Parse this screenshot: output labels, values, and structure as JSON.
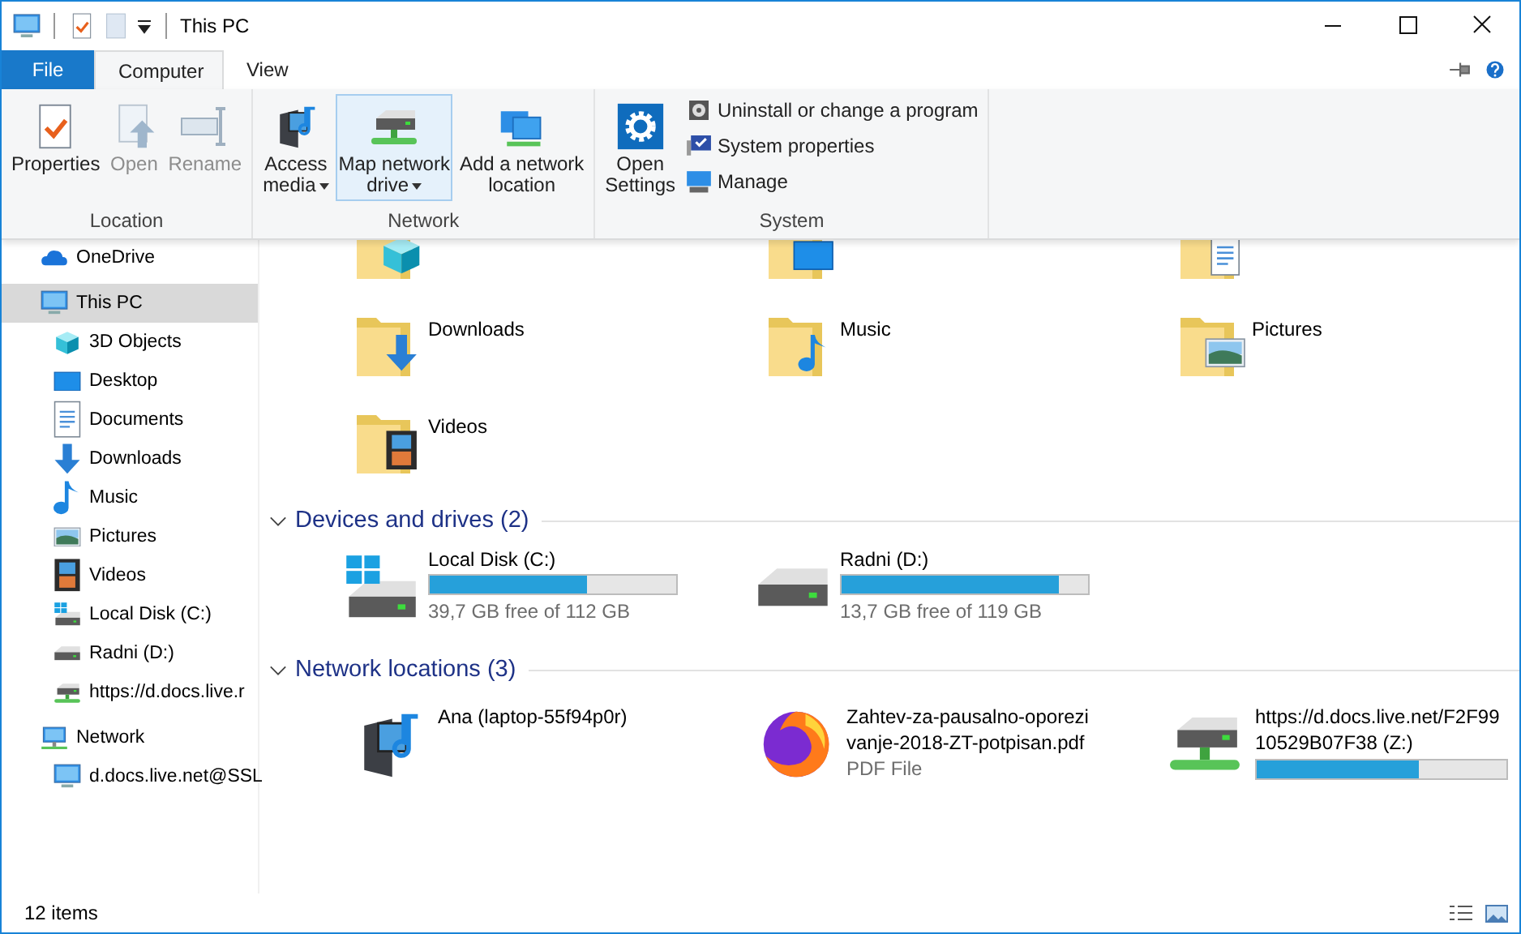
{
  "window": {
    "title": "This PC"
  },
  "ribbon": {
    "tabs": [
      {
        "label": "File",
        "kind": "file",
        "selected": false
      },
      {
        "label": "Computer",
        "kind": "tab",
        "selected": true
      },
      {
        "label": "View",
        "kind": "tab",
        "selected": false
      }
    ],
    "groups": [
      {
        "label": "Location",
        "buttons": [
          {
            "lines": [
              "Properties"
            ],
            "kind": "properties",
            "disabled": false,
            "dropdown": false,
            "highlighted": false
          },
          {
            "lines": [
              "Open"
            ],
            "kind": "open",
            "disabled": true,
            "dropdown": false,
            "highlighted": false
          },
          {
            "lines": [
              "Rename"
            ],
            "kind": "rename",
            "disabled": true,
            "dropdown": false,
            "highlighted": false
          }
        ]
      },
      {
        "label": "Network",
        "buttons": [
          {
            "lines": [
              "Access",
              "media"
            ],
            "kind": "access-media",
            "disabled": false,
            "dropdown": true,
            "highlighted": false
          },
          {
            "lines": [
              "Map network",
              "drive"
            ],
            "kind": "map-drive",
            "disabled": false,
            "dropdown": true,
            "highlighted": true
          },
          {
            "lines": [
              "Add a network",
              "location"
            ],
            "kind": "add-location",
            "disabled": false,
            "dropdown": false,
            "highlighted": false
          }
        ]
      },
      {
        "label": "System",
        "buttons": [
          {
            "lines": [
              "Open",
              "Settings"
            ],
            "kind": "settings",
            "disabled": false,
            "dropdown": false,
            "highlighted": false
          }
        ],
        "small_buttons": [
          {
            "label": "Uninstall or change a program",
            "kind": "uninstall"
          },
          {
            "label": "System properties",
            "kind": "sysprops"
          },
          {
            "label": "Manage",
            "kind": "manage"
          }
        ]
      }
    ]
  },
  "sidebar": {
    "items": [
      {
        "label": "OneDrive",
        "kind": "cloud",
        "selected": false
      },
      {
        "label": "This PC",
        "kind": "pc",
        "selected": true,
        "children": [
          {
            "label": "3D Objects",
            "kind": "cube",
            "selected": false
          },
          {
            "label": "Desktop",
            "kind": "desktop",
            "selected": false
          },
          {
            "label": "Documents",
            "kind": "documents",
            "selected": false
          },
          {
            "label": "Downloads",
            "kind": "downloads",
            "selected": false
          },
          {
            "label": "Music",
            "kind": "music",
            "selected": false
          },
          {
            "label": "Pictures",
            "kind": "pictures",
            "selected": false
          },
          {
            "label": "Videos",
            "kind": "videos",
            "selected": false
          },
          {
            "label": "Local Disk (C:)",
            "kind": "system-drive",
            "selected": false
          },
          {
            "label": "Radni (D:)",
            "kind": "drive",
            "selected": false
          },
          {
            "label": "https://d.docs.live.r",
            "kind": "network-drive",
            "selected": false
          }
        ]
      },
      {
        "label": "Network",
        "kind": "network",
        "selected": false,
        "children": [
          {
            "label": "d.docs.live.net@SSL",
            "kind": "pc",
            "selected": false
          }
        ]
      }
    ]
  },
  "folders": {
    "partially_hidden": [
      {
        "kind": "cube"
      },
      {
        "kind": "desktop"
      },
      {
        "kind": "documents"
      }
    ],
    "items": [
      {
        "label": "Downloads",
        "kind": "downloads"
      },
      {
        "label": "Music",
        "kind": "music"
      },
      {
        "label": "Pictures",
        "kind": "pictures"
      },
      {
        "label": "Videos",
        "kind": "videos"
      }
    ]
  },
  "devices": {
    "title": "Devices and drives (2)",
    "expanded": true,
    "drives": [
      {
        "name": "Local Disk (C:)",
        "kind": "system-drive",
        "level": 0.64,
        "free": "39,7 GB free of 112 GB"
      },
      {
        "name": "Radni (D:)",
        "kind": "drive",
        "level": 0.88,
        "free": "13,7 GB free of 119 GB"
      }
    ]
  },
  "network": {
    "title": "Network locations (3)",
    "expanded": true,
    "items": [
      {
        "lines": [
          "Ana (laptop-55f94p0r)"
        ],
        "kind": "media-server"
      },
      {
        "lines": [
          "Zahtev-za-pausalno-oporezi",
          "vanje-2018-ZT-potpisan.pdf"
        ],
        "subtitle": "PDF File",
        "kind": "browser"
      },
      {
        "lines": [
          "https://d.docs.live.net/F2F99",
          "10529B07F38 (Z:)"
        ],
        "kind": "network-drive",
        "level": 0.65
      }
    ]
  },
  "status_bar": {
    "count": "12 items"
  }
}
